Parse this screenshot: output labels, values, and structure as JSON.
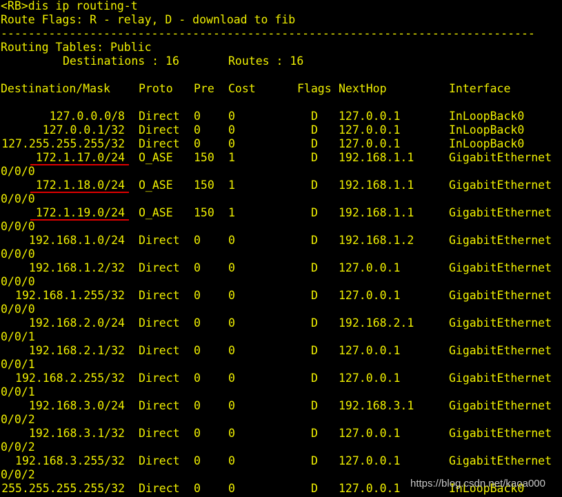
{
  "terminal": {
    "prompt_line": "<RB>dis ip routing-t",
    "route_flags": "Route Flags: R - relay, D - download to fib",
    "separator": "------------------------------------------------------------------------------",
    "tables_title": "Routing Tables: Public",
    "destinations_label": "Destinations : 16",
    "routes_label": "Routes : 16",
    "headers": {
      "destination": "Destination/Mask",
      "proto": "Proto",
      "pre": "Pre",
      "cost": "Cost",
      "flags": "Flags",
      "nexthop": "NextHop",
      "interface": "Interface"
    },
    "routes": [
      {
        "dest": "127.0.0.0/8",
        "proto": "Direct",
        "pre": "0",
        "cost": "0",
        "flags": "D",
        "nexthop": "127.0.0.1",
        "iface": "InLoopBack0",
        "cont": ""
      },
      {
        "dest": "127.0.0.1/32",
        "proto": "Direct",
        "pre": "0",
        "cost": "0",
        "flags": "D",
        "nexthop": "127.0.0.1",
        "iface": "InLoopBack0",
        "cont": ""
      },
      {
        "dest": "127.255.255.255/32",
        "proto": "Direct",
        "pre": "0",
        "cost": "0",
        "flags": "D",
        "nexthop": "127.0.0.1",
        "iface": "InLoopBack0",
        "cont": ""
      },
      {
        "dest": "172.1.17.0/24",
        "proto": "O_ASE",
        "pre": "150",
        "cost": "1",
        "flags": "D",
        "nexthop": "192.168.1.1",
        "iface": "GigabitEthernet",
        "cont": "0/0/0",
        "highlighted": true
      },
      {
        "dest": "172.1.18.0/24",
        "proto": "O_ASE",
        "pre": "150",
        "cost": "1",
        "flags": "D",
        "nexthop": "192.168.1.1",
        "iface": "GigabitEthernet",
        "cont": "0/0/0",
        "highlighted": true
      },
      {
        "dest": "172.1.19.0/24",
        "proto": "O_ASE",
        "pre": "150",
        "cost": "1",
        "flags": "D",
        "nexthop": "192.168.1.1",
        "iface": "GigabitEthernet",
        "cont": "0/0/0",
        "highlighted": true
      },
      {
        "dest": "192.168.1.0/24",
        "proto": "Direct",
        "pre": "0",
        "cost": "0",
        "flags": "D",
        "nexthop": "192.168.1.2",
        "iface": "GigabitEthernet",
        "cont": "0/0/0"
      },
      {
        "dest": "192.168.1.2/32",
        "proto": "Direct",
        "pre": "0",
        "cost": "0",
        "flags": "D",
        "nexthop": "127.0.0.1",
        "iface": "GigabitEthernet",
        "cont": "0/0/0"
      },
      {
        "dest": "192.168.1.255/32",
        "proto": "Direct",
        "pre": "0",
        "cost": "0",
        "flags": "D",
        "nexthop": "127.0.0.1",
        "iface": "GigabitEthernet",
        "cont": "0/0/0"
      },
      {
        "dest": "192.168.2.0/24",
        "proto": "Direct",
        "pre": "0",
        "cost": "0",
        "flags": "D",
        "nexthop": "192.168.2.1",
        "iface": "GigabitEthernet",
        "cont": "0/0/1"
      },
      {
        "dest": "192.168.2.1/32",
        "proto": "Direct",
        "pre": "0",
        "cost": "0",
        "flags": "D",
        "nexthop": "127.0.0.1",
        "iface": "GigabitEthernet",
        "cont": "0/0/1"
      },
      {
        "dest": "192.168.2.255/32",
        "proto": "Direct",
        "pre": "0",
        "cost": "0",
        "flags": "D",
        "nexthop": "127.0.0.1",
        "iface": "GigabitEthernet",
        "cont": "0/0/1"
      },
      {
        "dest": "192.168.3.0/24",
        "proto": "Direct",
        "pre": "0",
        "cost": "0",
        "flags": "D",
        "nexthop": "192.168.3.1",
        "iface": "GigabitEthernet",
        "cont": "0/0/2"
      },
      {
        "dest": "192.168.3.1/32",
        "proto": "Direct",
        "pre": "0",
        "cost": "0",
        "flags": "D",
        "nexthop": "127.0.0.1",
        "iface": "GigabitEthernet",
        "cont": "0/0/2"
      },
      {
        "dest": "192.168.3.255/32",
        "proto": "Direct",
        "pre": "0",
        "cost": "0",
        "flags": "D",
        "nexthop": "127.0.0.1",
        "iface": "GigabitEthernet",
        "cont": "0/0/2"
      },
      {
        "dest": "255.255.255.255/32",
        "proto": "Direct",
        "pre": "0",
        "cost": "0",
        "flags": "D",
        "nexthop": "127.0.0.1",
        "iface": "InLoopBack0",
        "cont": ""
      }
    ],
    "text_color": "#f0f000",
    "background_color": "#000000",
    "highlight_color": "#e00000"
  },
  "watermark": "https://blog.csdn.net/kaoa000"
}
